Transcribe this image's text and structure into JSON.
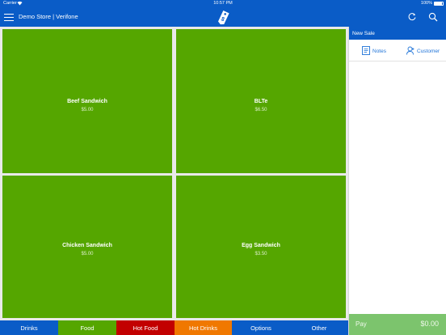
{
  "status_bar": {
    "carrier": "Carrier",
    "time": "10:57 PM",
    "battery": "100%"
  },
  "header": {
    "store_name": "Demo Store | Verifone"
  },
  "tiles": [
    {
      "name": "Beef Sandwich",
      "price": "$5.00"
    },
    {
      "name": "BLTe",
      "price": "$6.50"
    },
    {
      "name": "Chicken Sandwich",
      "price": "$5.00"
    },
    {
      "name": "Egg Sandwich",
      "price": "$3.50"
    }
  ],
  "sale_panel": {
    "title": "New Sale",
    "notes_label": "Notes",
    "customer_label": "Customer",
    "pay_label": "Pay",
    "total": "$0.00"
  },
  "categories": [
    {
      "label": "Drinks",
      "color": "#0a5cc7"
    },
    {
      "label": "Food",
      "color": "#55a600"
    },
    {
      "label": "Hot Food",
      "color": "#c20000"
    },
    {
      "label": "Hot Drinks",
      "color": "#f07800"
    },
    {
      "label": "Options",
      "color": "#0a5cc7"
    },
    {
      "label": "Other",
      "color": "#0a5cc7"
    }
  ],
  "colors": {
    "brand_blue": "#0a5cc7",
    "tile_green": "#55a600",
    "pay_green": "#7cc46d"
  }
}
